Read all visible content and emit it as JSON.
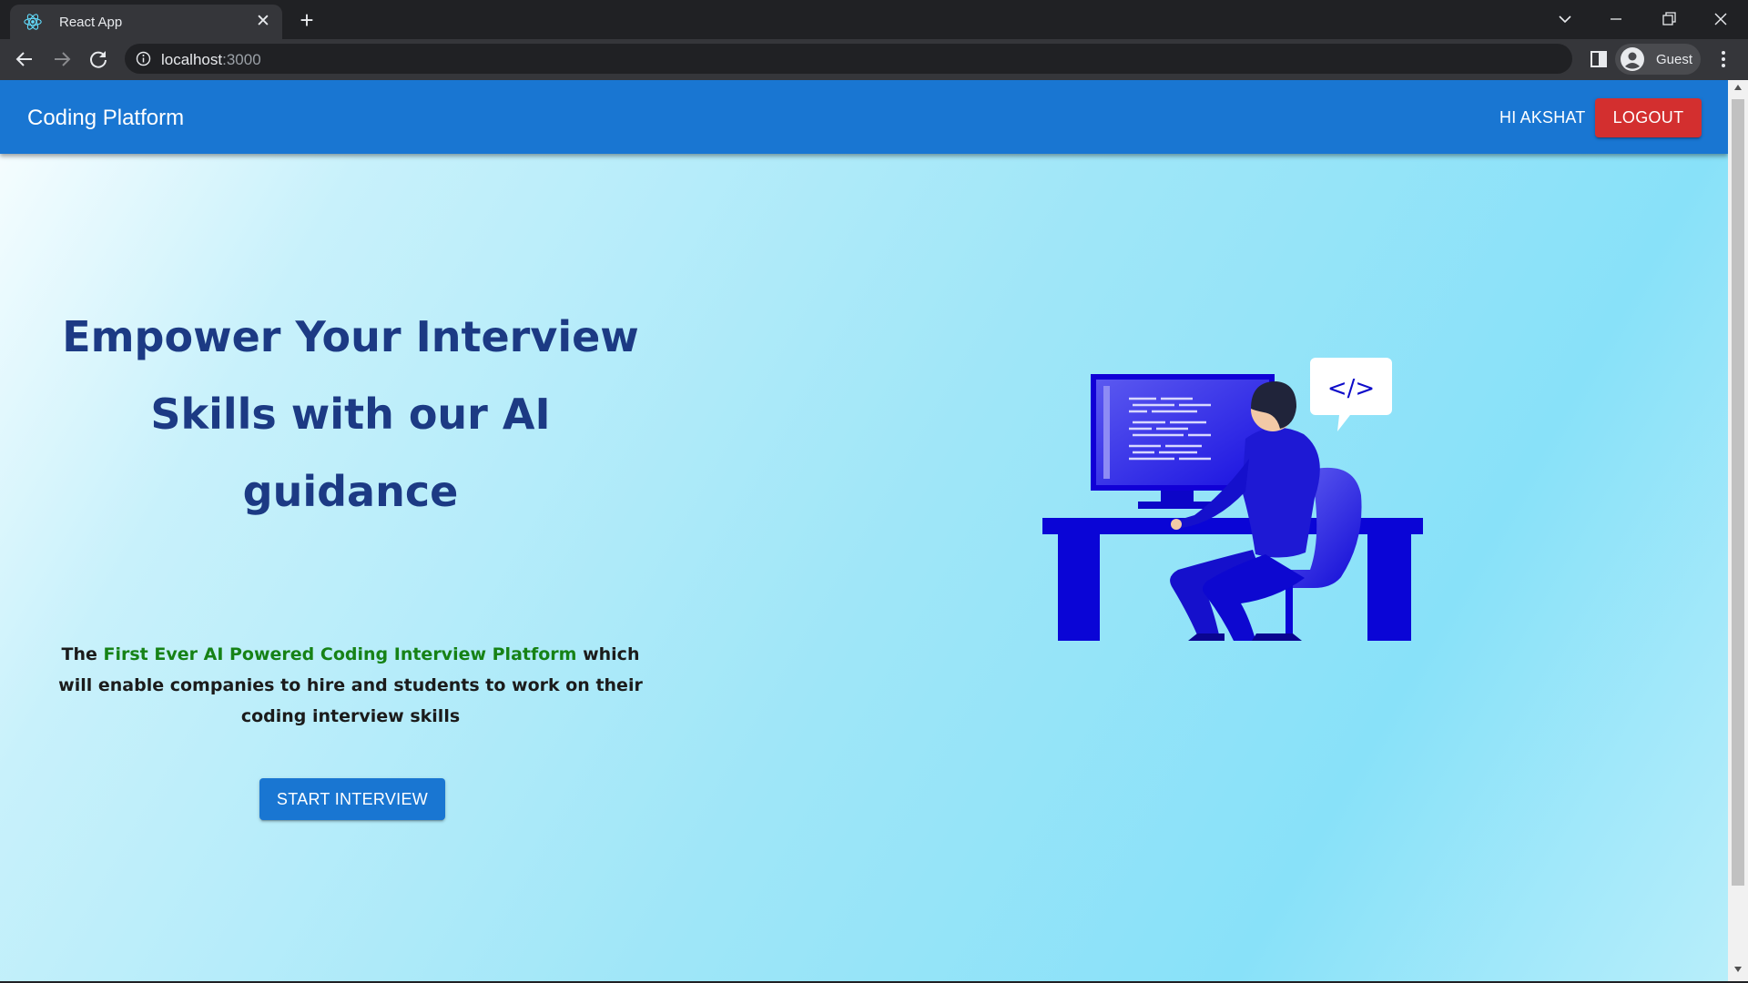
{
  "browser": {
    "tab_title": "React App",
    "url_host": "localhost",
    "url_port": ":3000",
    "profile_name": "Guest"
  },
  "navbar": {
    "brand": "Coding Platform",
    "greeting": "HI AKSHAT",
    "logout_label": "LOGOUT",
    "color": "#1976d2",
    "logout_color": "#d32f2f"
  },
  "hero": {
    "headline": "Empower Your Interview Skills with our AI guidance",
    "desc_prefix": "The ",
    "desc_highlight": "First Ever AI Powered Coding Interview Platform",
    "desc_suffix": " which will enable companies to hire and students to work on their coding interview skills",
    "start_label": "START INTERVIEW",
    "headline_color": "#1c3a84",
    "highlight_color": "#168216"
  },
  "illustration": {
    "speech_bubble_text": "</>",
    "icon": "programmer-at-desk-illustration",
    "primary_color": "#0a05d6"
  }
}
